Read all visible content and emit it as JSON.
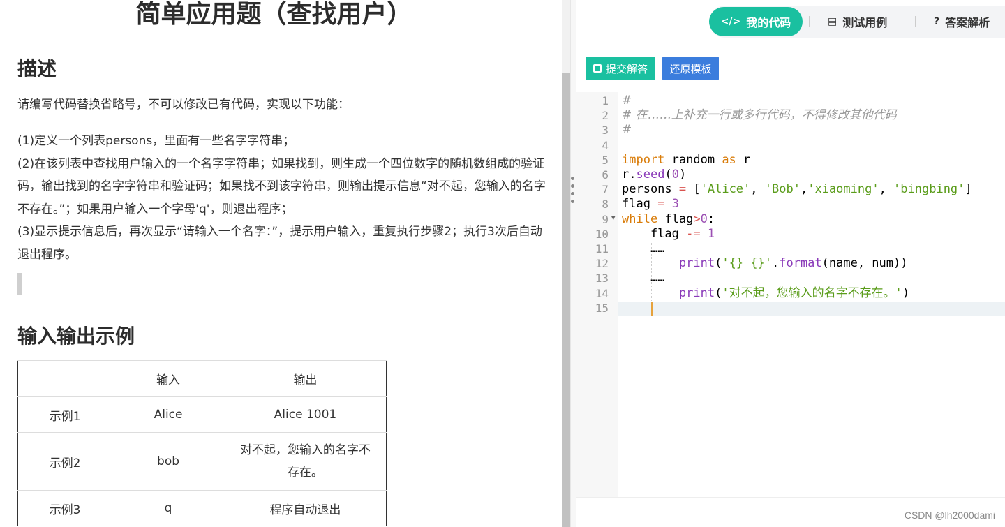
{
  "problem": {
    "title": "简单应用题（查找用户）",
    "description_heading": "描述",
    "intro": "请编写代码替换省略号，不可以修改已有代码，实现以下功能：",
    "items": [
      "(1)定义一个列表persons，里面有一些名字字符串；",
      "(2)在该列表中查找用户输入的一个名字字符串；如果找到，则生成一个四位数字的随机数组成的验证码，输出找到的名字字符串和验证码；如果找不到该字符串，则输出提示信息“对不起，您输入的名字不存在。”；如果用户输入一个字母'q'，则退出程序；",
      "(3)显示提示信息后，再次显示“请输入一个名字：”，提示用户输入，重复执行步骤2；执行3次后自动退出程序。"
    ],
    "io_heading": "输入输出示例",
    "table": {
      "headers": [
        "",
        "输入",
        "输出"
      ],
      "rows": [
        [
          "示例1",
          "Alice",
          "Alice 1001"
        ],
        [
          "示例2",
          "bob",
          "对不起，您输入的名字不存在。"
        ],
        [
          "示例3",
          "q",
          "程序自动退出"
        ]
      ]
    }
  },
  "tabs": [
    {
      "label": "我的代码",
      "icon": "code-icon",
      "active": true
    },
    {
      "label": "测试用例",
      "icon": "list-icon",
      "active": false
    },
    {
      "label": "答案解析",
      "icon": "question-icon",
      "active": false
    }
  ],
  "buttons": {
    "submit": "提交解答",
    "reset": "还原模板"
  },
  "editor": {
    "line_numbers": [
      "1",
      "2",
      "3",
      "4",
      "5",
      "6",
      "7",
      "8",
      "9",
      "10",
      "11",
      "12",
      "13",
      "14",
      "15"
    ],
    "active_line": 15,
    "lines": [
      "#",
      "# 在……上补充一行或多行代码，不得修改其他代码",
      "#",
      "",
      "import random as r",
      "r.seed(0)",
      "persons = ['Alice', 'Bob','xiaoming', 'bingbing']",
      "flag = 3",
      "while flag>0:",
      "    flag -= 1",
      "    ……",
      "        print('{} {}'.format(name, num))",
      "    ……",
      "        print('对不起，您输入的名字不存在。')",
      ""
    ]
  },
  "watermark": "CSDN @lh2000dami"
}
